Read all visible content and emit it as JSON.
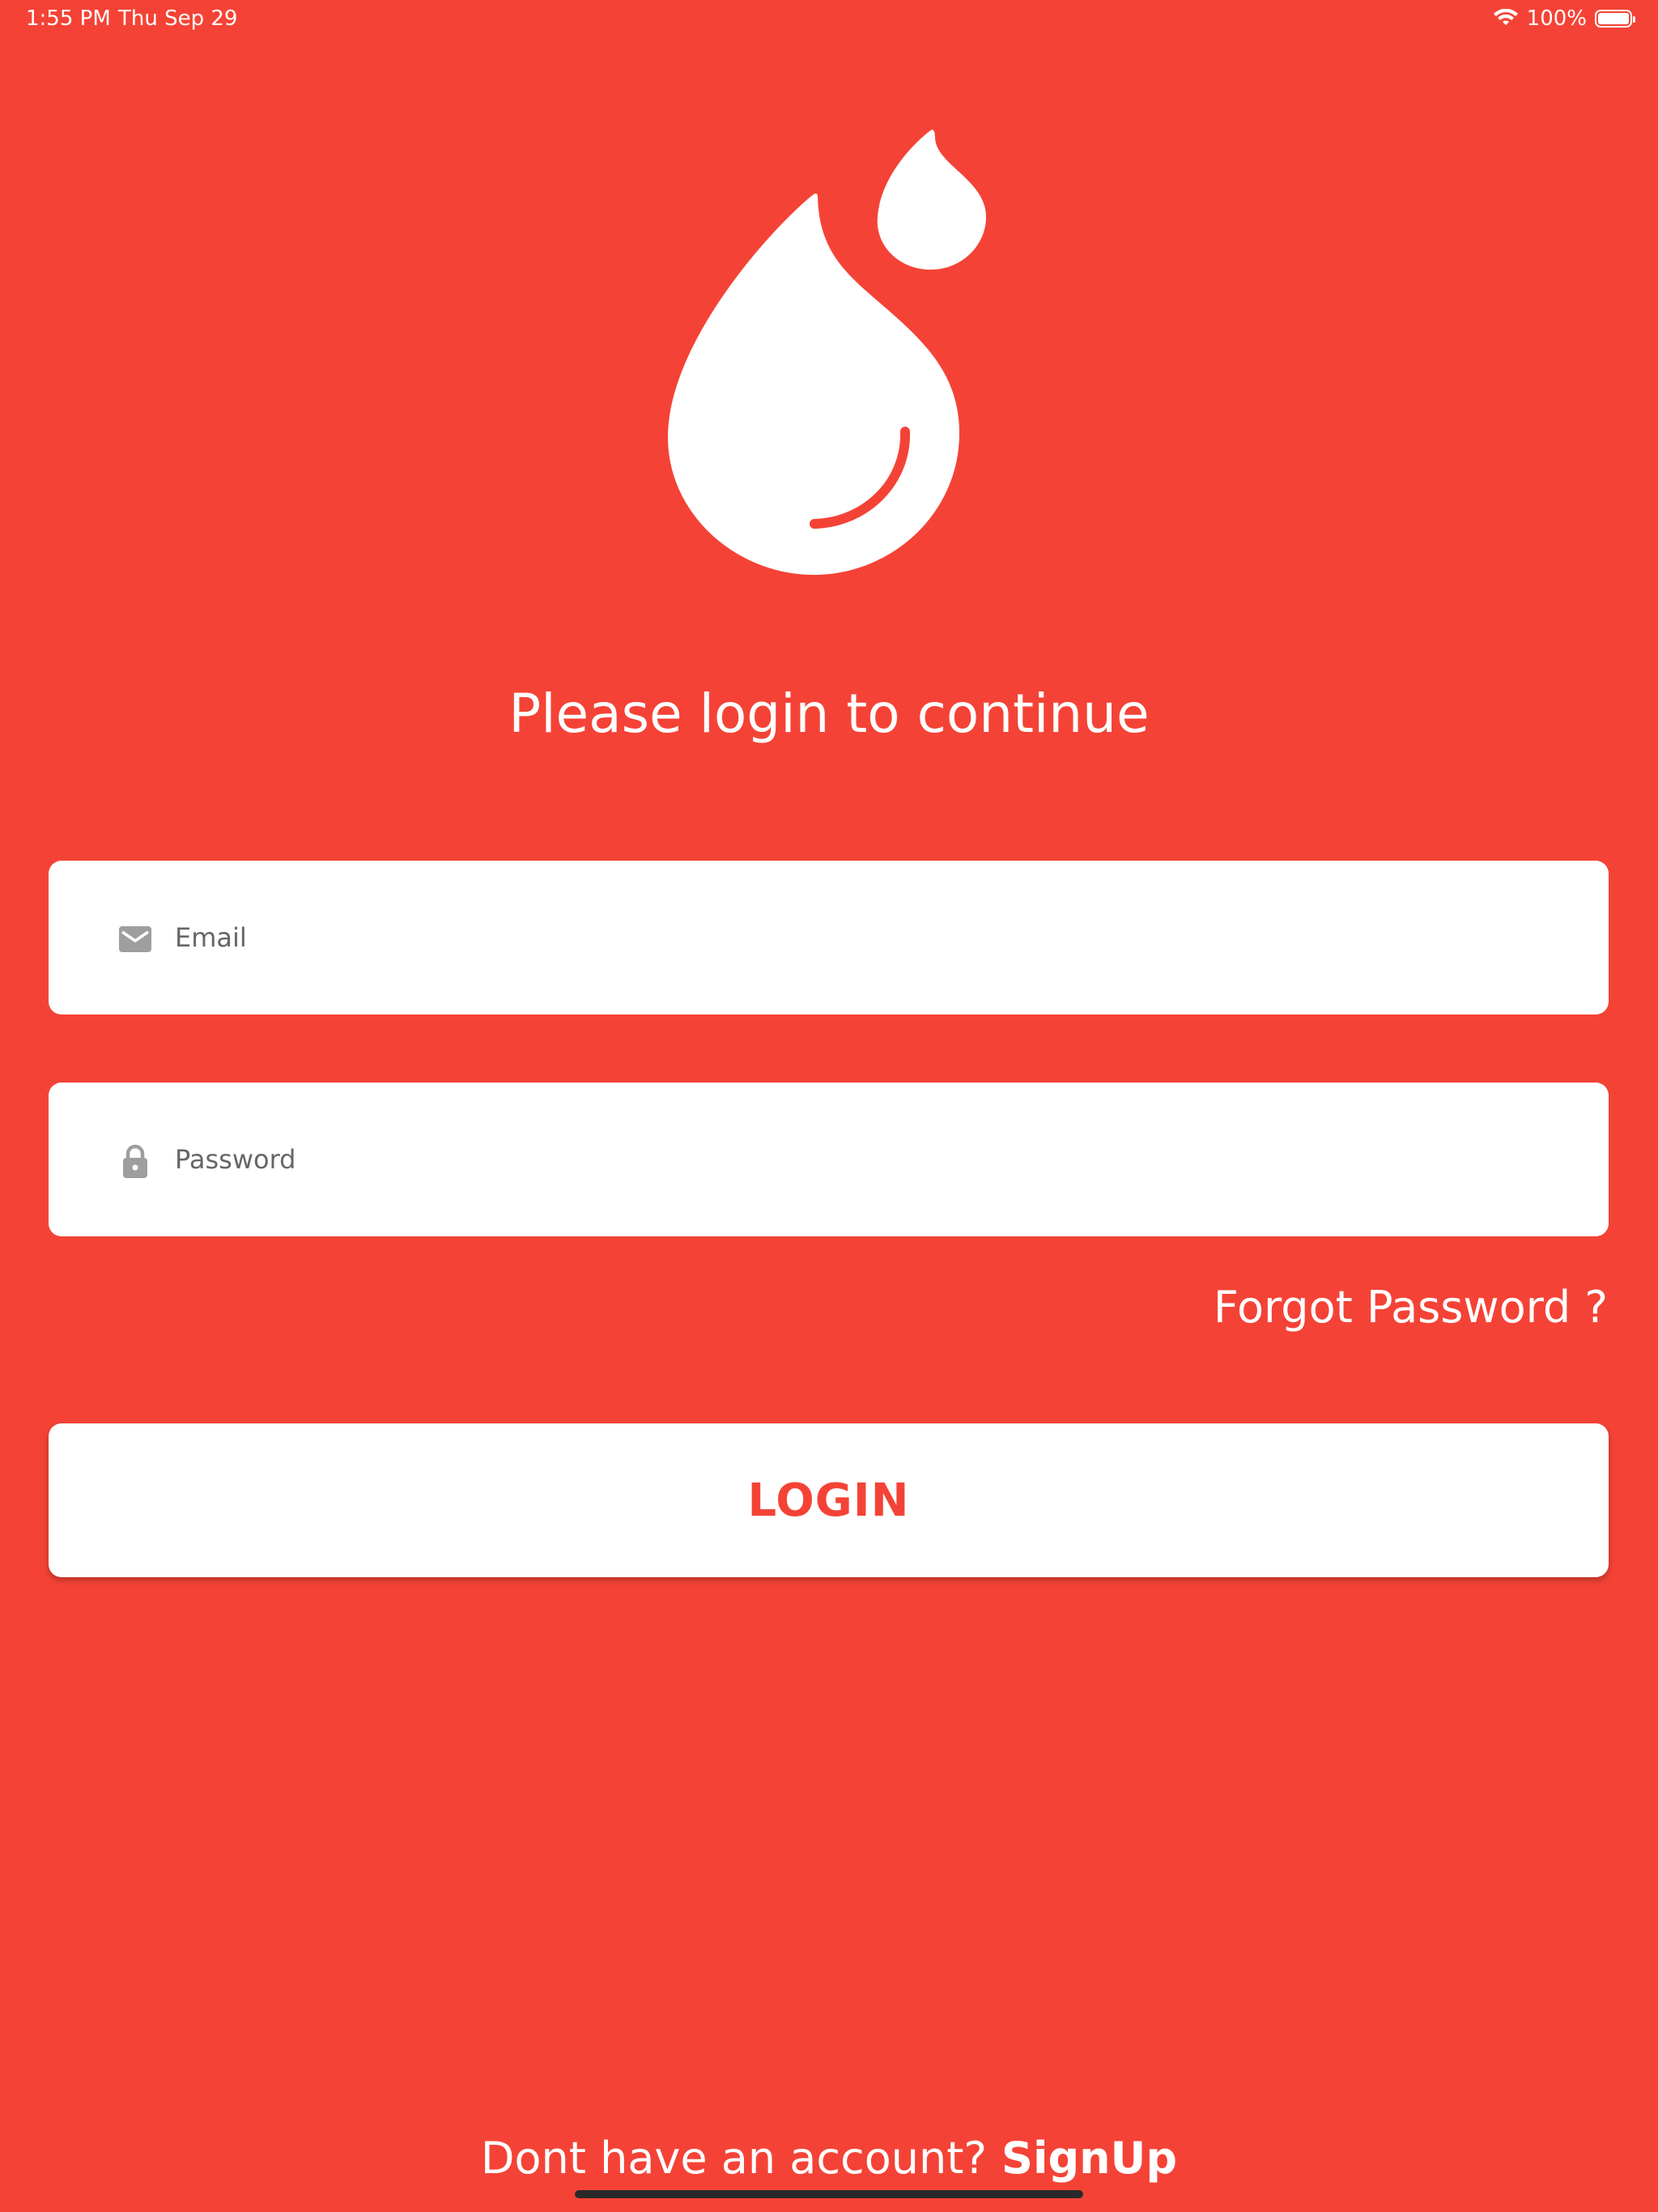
{
  "status_bar": {
    "time": "1:55 PM",
    "date": "Thu Sep 29",
    "battery_percent": "100%",
    "battery_level": 1.0,
    "icons": [
      "wifi-icon",
      "battery-icon"
    ]
  },
  "logo": {
    "icon": "blood-drop-icon"
  },
  "title": "Please login to continue",
  "form": {
    "email": {
      "placeholder": "Email",
      "value": "",
      "icon": "mail-icon"
    },
    "password": {
      "placeholder": "Password",
      "value": "",
      "icon": "lock-icon"
    }
  },
  "forgot_password_label": "Forgot Password ?",
  "login_button_label": "LOGIN",
  "signup": {
    "prompt": "Dont have an account?",
    "link_label": "SignUp"
  },
  "colors": {
    "background": "#F44336",
    "surface": "#FFFFFF",
    "accent": "#F44336",
    "icon_gray": "#9E9E9E",
    "home_indicator": "#2A2A2A"
  }
}
